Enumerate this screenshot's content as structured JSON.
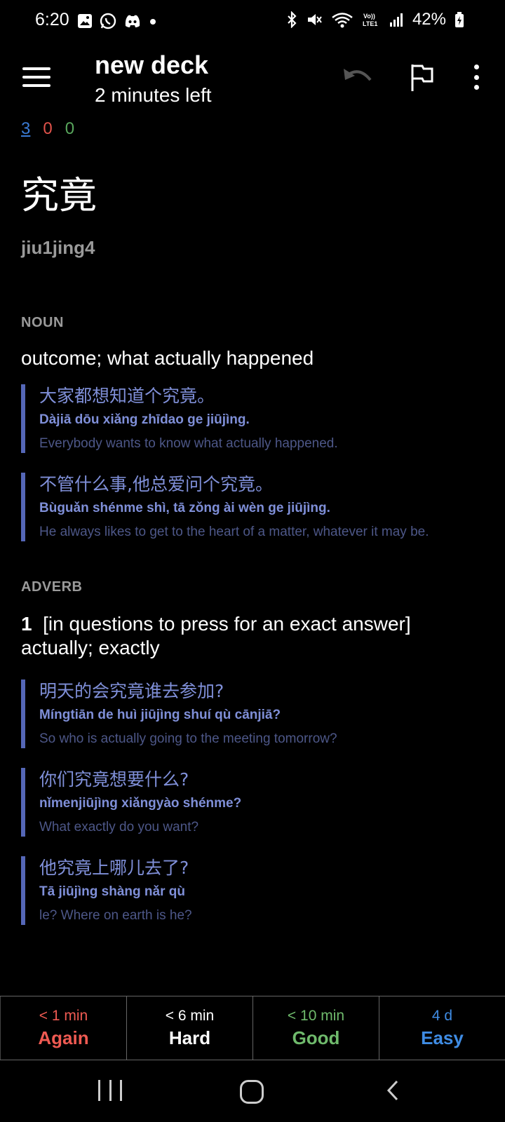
{
  "status_bar": {
    "time": "6:20",
    "battery": "42%",
    "notification_icons": [
      "gallery-icon",
      "whatsapp-icon",
      "discord-icon",
      "dot-icon"
    ],
    "system_icons": [
      "bluetooth-icon",
      "mute-icon",
      "wifi-icon",
      "volte-icon",
      "signal-icon",
      "battery-icon"
    ]
  },
  "header": {
    "title": "new deck",
    "subtitle": "2 minutes left"
  },
  "counts": {
    "new": "3",
    "learning": "0",
    "review": "0"
  },
  "card": {
    "hanzi": "究竟",
    "pinyin": "jiu1jing4",
    "sections": [
      {
        "pos": "NOUN",
        "definition": "outcome; what actually happened",
        "examples": [
          {
            "zh": "大家都想知道个究竟。",
            "py": "Dàjiā dōu xiǎng zhīdao ge jiūjìng.",
            "en": "Everybody wants to know what actually happened."
          },
          {
            "zh": "不管什么事,他总爱问个究竟。",
            "py": "Bùguǎn shénme shì, tā zǒng ài wèn ge jiūjìng.",
            "en": "He always likes to get to the heart of a matter, whatever it may be."
          }
        ]
      },
      {
        "pos": "ADVERB",
        "number": "1",
        "definition": "[in questions to press for an exact answer] actually; exactly",
        "examples": [
          {
            "zh": "明天的会究竟谁去参加?",
            "py": "Míngtiān de huì jiūjìng shuí qù cānjiā?",
            "en": "So who is actually going to the meeting tomorrow?"
          },
          {
            "zh": "你们究竟想要什么?",
            "py": "nǐmenjiūjìng xiǎngyào shénme?",
            "en": "What exactly do you want?"
          },
          {
            "zh": "他究竟上哪儿去了?",
            "py": "Tā jiūjìng shàng nǎr qù",
            "en": "le?   Where on earth is he?"
          }
        ]
      }
    ]
  },
  "answers": [
    {
      "time": "< 1 min",
      "label": "Again"
    },
    {
      "time": "< 6 min",
      "label": "Hard"
    },
    {
      "time": "< 10 min",
      "label": "Good"
    },
    {
      "time": "4 d",
      "label": "Easy"
    }
  ],
  "colors": {
    "new": "#3a7bd5",
    "learning": "#e0524a",
    "review": "#58a65c",
    "example_accent": "#5567b7",
    "example_text": "#7f8fd8"
  }
}
